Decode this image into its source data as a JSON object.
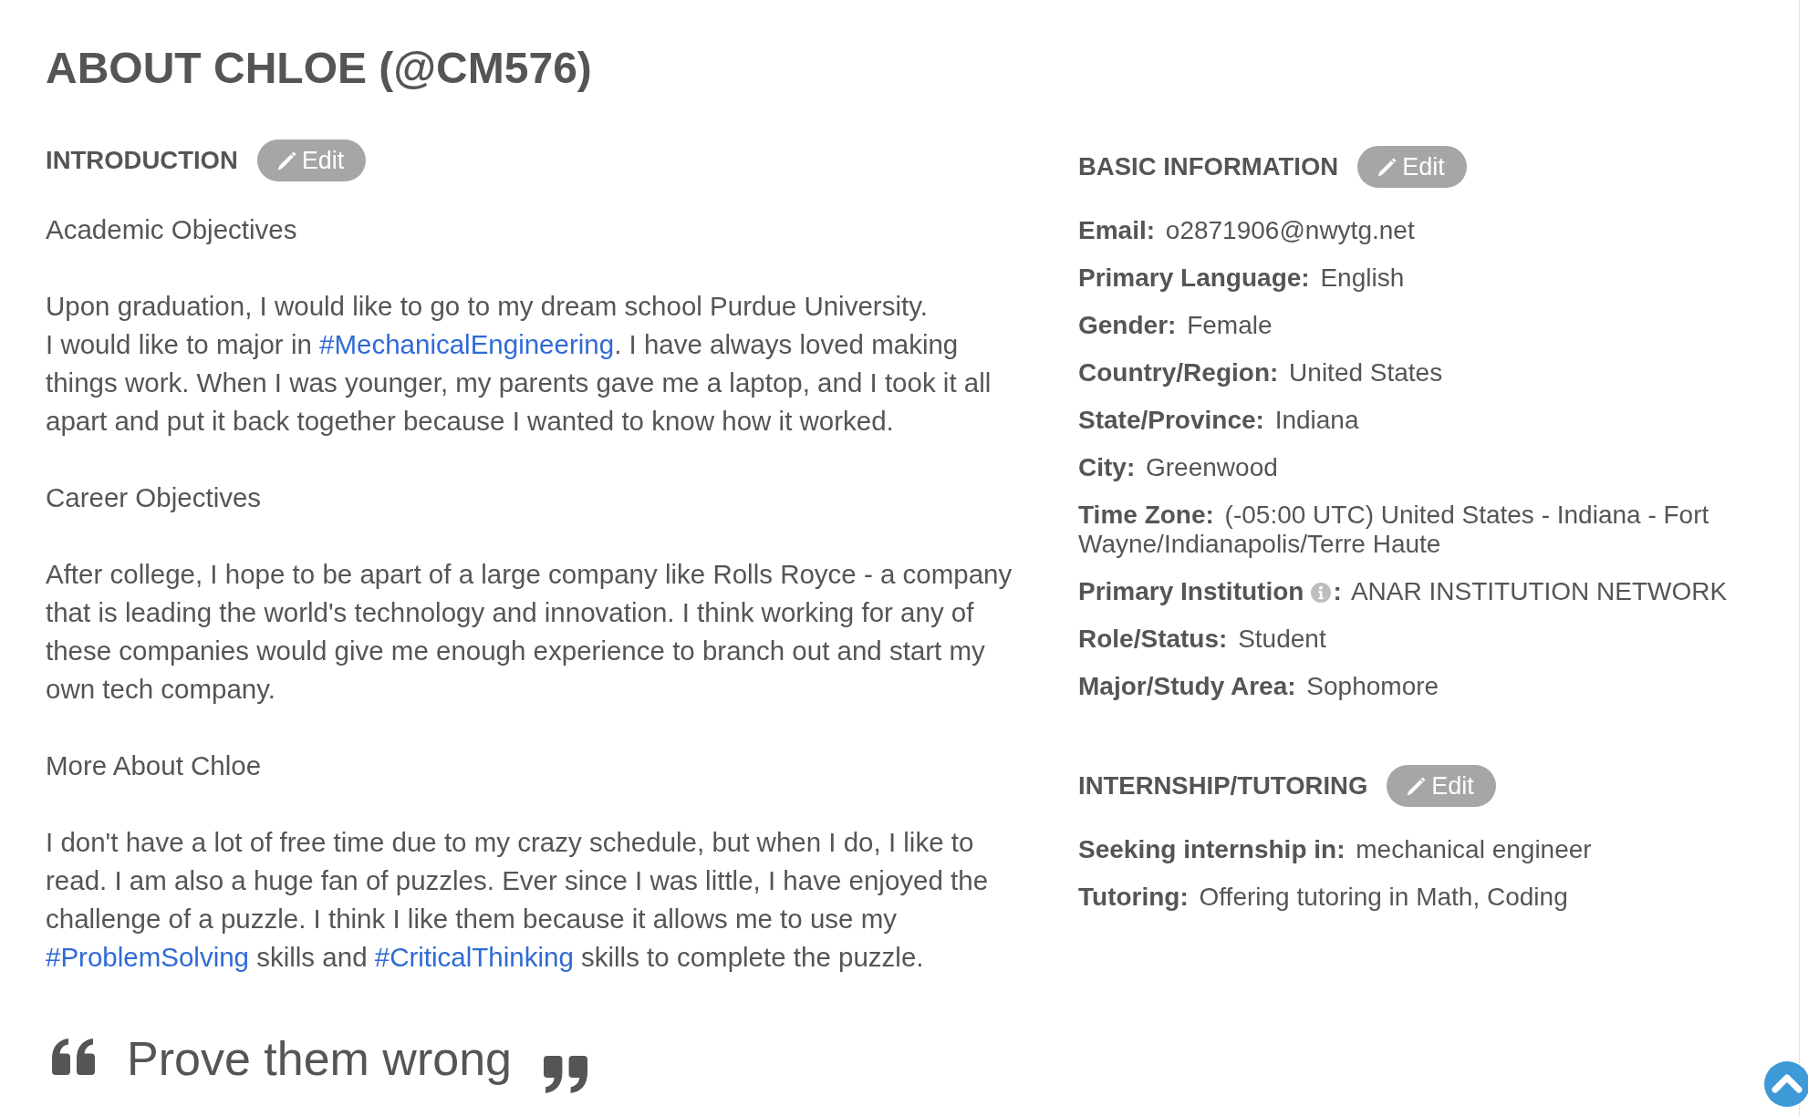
{
  "page": {
    "title": "ABOUT CHLOE (@CM576)"
  },
  "introduction": {
    "heading": "INTRODUCTION",
    "edit_button": "Edit",
    "blocks": [
      {
        "kind": "subheading",
        "text": "Academic Objectives"
      },
      {
        "kind": "paragraph",
        "lines": [
          [
            {
              "kind": "text",
              "text": "Upon graduation, I would like to go to my dream school Purdue University."
            }
          ],
          [
            {
              "kind": "text",
              "text": "I would like to major in "
            },
            {
              "kind": "hashtag",
              "text": "#MechanicalEngineering"
            },
            {
              "kind": "text",
              "text": ". I have always loved making things work. When I was younger, my parents gave me a laptop, and I took it all apart and put it back together because I wanted to know how it worked."
            }
          ]
        ]
      },
      {
        "kind": "subheading",
        "text": "Career Objectives"
      },
      {
        "kind": "paragraph",
        "lines": [
          [
            {
              "kind": "text",
              "text": "After college, I hope to be apart of a large company like Rolls Royce - a company that is leading the world's technology and innovation. I think working for any of these companies would give me enough experience to branch out and start my own tech company."
            }
          ]
        ]
      },
      {
        "kind": "subheading",
        "text": "More About Chloe"
      },
      {
        "kind": "paragraph",
        "lines": [
          [
            {
              "kind": "text",
              "text": "I don't have a lot of free time due to my crazy schedule, but when I do, I like to read. I am also a huge fan of puzzles. Ever since I was little, I have enjoyed the challenge of a puzzle. I think I like them because it allows me to use my "
            },
            {
              "kind": "hashtag",
              "text": "#ProblemSolving"
            },
            {
              "kind": "text",
              "text": " skills and "
            },
            {
              "kind": "hashtag",
              "text": "#CriticalThinking"
            },
            {
              "kind": "text",
              "text": " skills to complete the puzzle."
            }
          ]
        ]
      }
    ]
  },
  "quote": {
    "text": "Prove them wrong"
  },
  "basic_information": {
    "heading": "BASIC INFORMATION",
    "edit_button": "Edit",
    "fields": [
      {
        "label": "Email:",
        "value": "o2871906@nwytg.net",
        "info_icon": false
      },
      {
        "label": "Primary Language:",
        "value": "English",
        "info_icon": false
      },
      {
        "label": "Gender:",
        "value": "Female",
        "info_icon": false
      },
      {
        "label": "Country/Region:",
        "value": "United States",
        "info_icon": false
      },
      {
        "label": "State/Province:",
        "value": "Indiana",
        "info_icon": false
      },
      {
        "label": "City:",
        "value": "Greenwood",
        "info_icon": false
      },
      {
        "label": "Time Zone:",
        "value": "(-05:00 UTC) United States - Indiana - Fort Wayne/Indianapolis/Terre Haute",
        "info_icon": false
      },
      {
        "label": "Primary Institution",
        "label_end": ":",
        "value": "ANAR INSTITUTION NETWORK",
        "info_icon": true
      },
      {
        "label": "Role/Status:",
        "value": "Student",
        "info_icon": false
      },
      {
        "label": "Major/Study Area:",
        "value": "Sophomore",
        "info_icon": false
      }
    ]
  },
  "internship_tutoring": {
    "heading": "INTERNSHIP/TUTORING",
    "edit_button": "Edit",
    "fields": [
      {
        "label": "Seeking internship in:",
        "value": "mechanical engineer",
        "info_icon": false
      },
      {
        "label": "Tutoring:",
        "value": "Offering tutoring in Math, Coding",
        "info_icon": false
      }
    ]
  }
}
